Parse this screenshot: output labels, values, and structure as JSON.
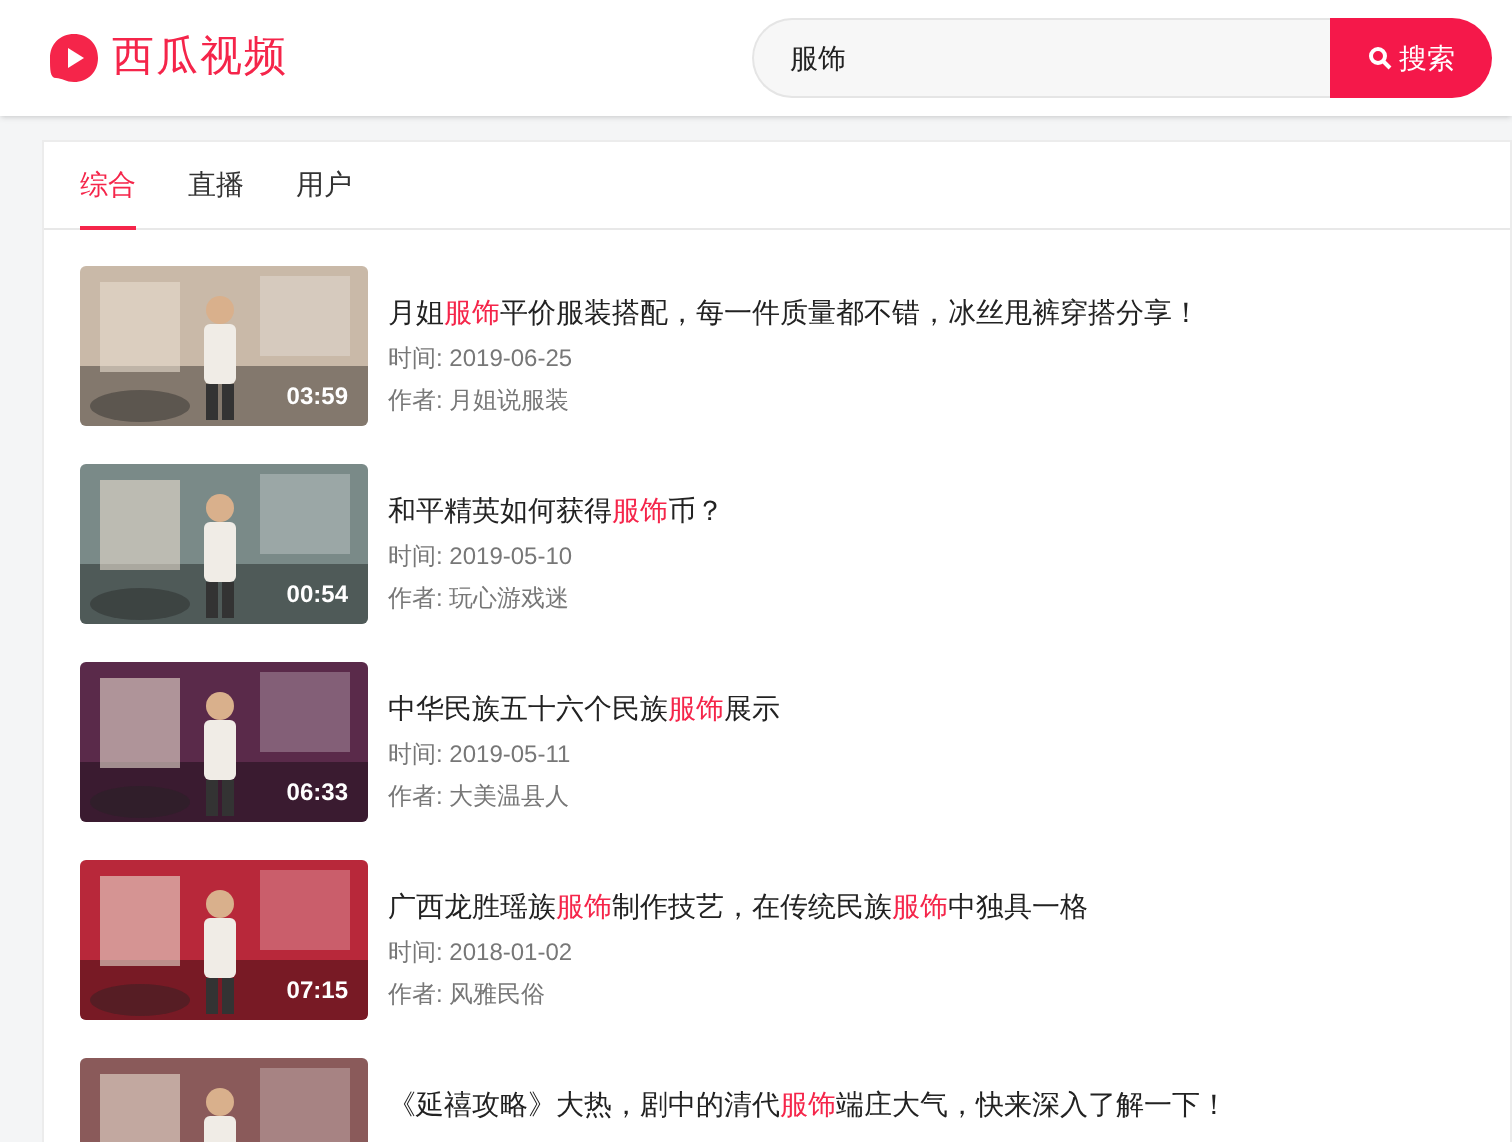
{
  "header": {
    "logo_text": "西瓜视频",
    "search": {
      "value": "服饰",
      "button": "搜索"
    }
  },
  "tabs": [
    {
      "label": "综合",
      "selected": true
    },
    {
      "label": "直播",
      "selected": false
    },
    {
      "label": "用户",
      "selected": false
    }
  ],
  "results": [
    {
      "title": [
        {
          "text": "月姐",
          "highlight": false
        },
        {
          "text": "服饰",
          "highlight": true
        },
        {
          "text": "平价服装搭配，每一件质量都不错，冰丝甩裤穿搭分享！",
          "highlight": false
        }
      ],
      "time": "时间: 2019-06-25",
      "author": "作者: 月姐说服装",
      "duration": "03:59"
    },
    {
      "title": [
        {
          "text": "和平精英如何获得",
          "highlight": false
        },
        {
          "text": "服饰",
          "highlight": true
        },
        {
          "text": "币？",
          "highlight": false
        }
      ],
      "time": "时间: 2019-05-10",
      "author": "作者: 玩心游戏迷",
      "duration": "00:54"
    },
    {
      "title": [
        {
          "text": "中华民族五十六个民族",
          "highlight": false
        },
        {
          "text": "服饰",
          "highlight": true
        },
        {
          "text": "展示",
          "highlight": false
        }
      ],
      "time": "时间: 2019-05-11",
      "author": "作者: 大美温县人",
      "duration": "06:33"
    },
    {
      "title": [
        {
          "text": "广西龙胜瑶族",
          "highlight": false
        },
        {
          "text": "服饰",
          "highlight": true
        },
        {
          "text": "制作技艺，在传统民族",
          "highlight": false
        },
        {
          "text": "服饰",
          "highlight": true
        },
        {
          "text": "中独具一格",
          "highlight": false
        }
      ],
      "time": "时间: 2018-01-02",
      "author": "作者: 风雅民俗",
      "duration": "07:15"
    },
    {
      "title": [
        {
          "text": "《延禧攻略》大热，剧中的清代",
          "highlight": false
        },
        {
          "text": "服饰",
          "highlight": true
        },
        {
          "text": "端庄大气，快来深入了解一下！",
          "highlight": false
        }
      ]
    }
  ]
}
